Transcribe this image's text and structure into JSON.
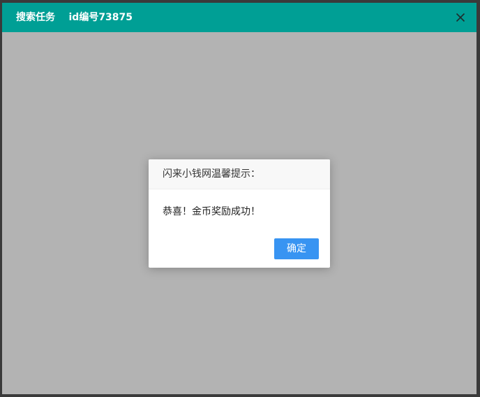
{
  "window": {
    "title": "搜索任务    id编号73875",
    "close_icon": "close-icon",
    "titlebar_color": "#009f95",
    "backdrop_color": "#b3b3b3"
  },
  "dialog": {
    "title": "闪来小钱网温馨提示：",
    "message": "恭喜！金币奖励成功！",
    "confirm_label": "确定",
    "confirm_color": "#3894f2"
  }
}
